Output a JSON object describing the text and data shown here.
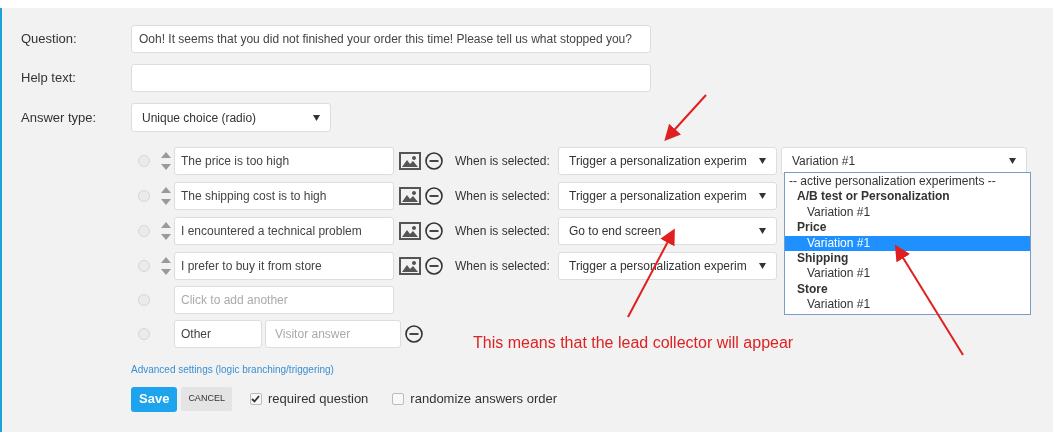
{
  "fields": [
    {
      "label": "Question:",
      "value": "Ooh! It seems that you did not finished your order this time! Please tell us what stopped you?"
    },
    {
      "label": "Help text:"
    }
  ],
  "answer_type": {
    "label": "Answer type:",
    "value": "Unique choice (radio)"
  },
  "answers": [
    {
      "selected": false,
      "text": "The price is too high",
      "when_label": "When is selected:",
      "action": "Trigger a personalization experim",
      "variation": "Variation #1"
    },
    {
      "selected": false,
      "text": "The shipping cost is to high",
      "when_label": "When is selected:",
      "action": "Trigger a personalization experim"
    },
    {
      "selected": false,
      "text": "I encountered a technical problem",
      "when_label": "When is selected:",
      "action": "Go to end screen"
    },
    {
      "selected": false,
      "text": "I prefer to buy it from store",
      "when_label": "When is selected:",
      "action": "Trigger a personalization experim"
    }
  ],
  "add_row": {
    "selected": false,
    "placeholder": "Click to add another"
  },
  "other": {
    "selected": false,
    "value": "Other",
    "placeholder": "Visitor answer"
  },
  "dropdown": [
    {
      "kind": "header",
      "text": "-- active personalization experiments --",
      "selected": false
    },
    {
      "kind": "group",
      "text": "A/B test or Personalization",
      "selected": false
    },
    {
      "kind": "option",
      "text": "Variation #1",
      "selected": false
    },
    {
      "kind": "group",
      "text": "Price",
      "selected": false
    },
    {
      "kind": "option",
      "text": "Variation #1",
      "selected": true
    },
    {
      "kind": "group",
      "text": "Shipping",
      "selected": false
    },
    {
      "kind": "option",
      "text": "Variation #1",
      "selected": false
    },
    {
      "kind": "group",
      "text": "Store",
      "selected": false
    },
    {
      "kind": "option",
      "text": "Variation #1",
      "selected": false
    }
  ],
  "note": "This means that the lead collector will appear",
  "advanced_link": "Advanced settings (logic branching/triggering)",
  "save": "Save",
  "cancel": "CANCEL",
  "options": [
    {
      "label": "required question",
      "checked": true
    },
    {
      "label": "randomize answers order",
      "checked": false
    }
  ]
}
